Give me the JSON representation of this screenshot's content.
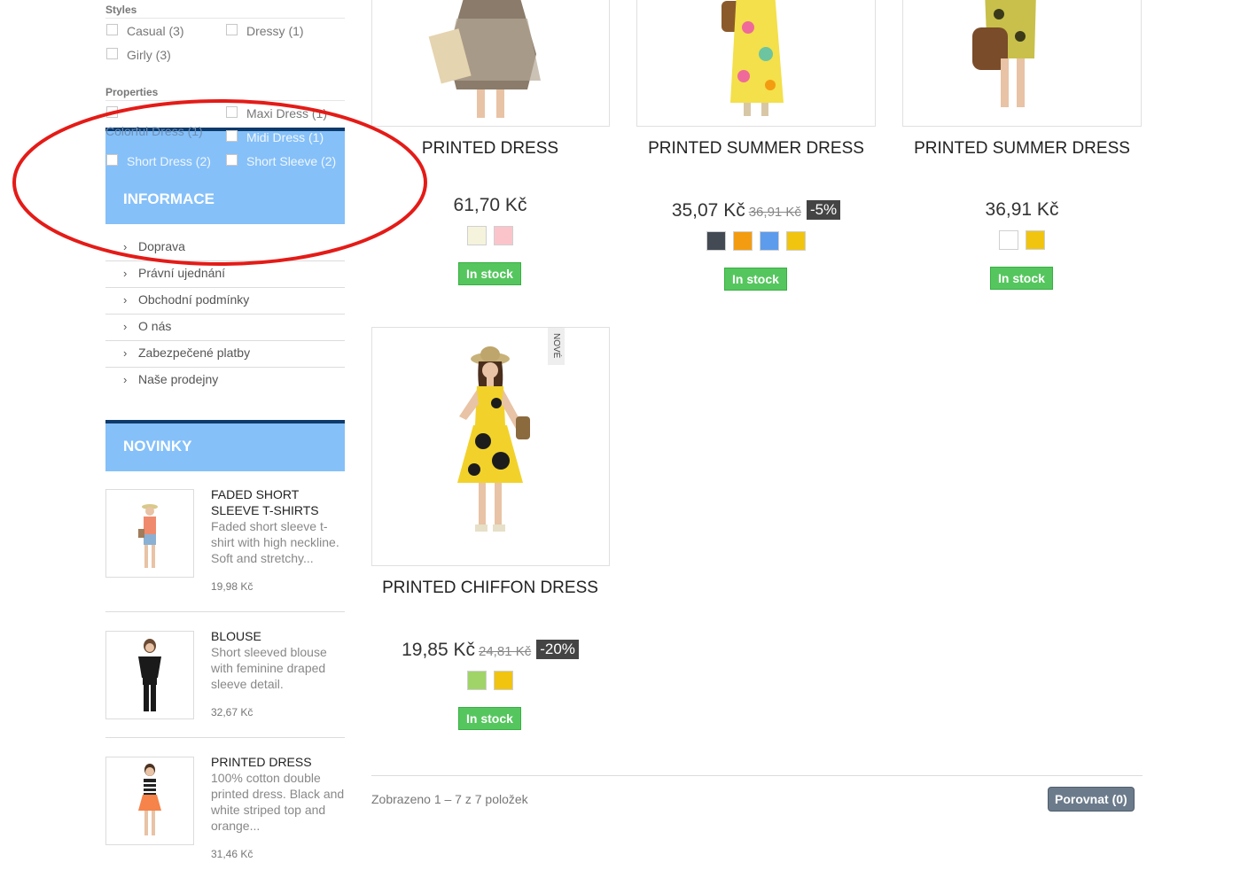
{
  "filters": {
    "styles": {
      "title": "Styles",
      "options": [
        {
          "label": "Casual (3)"
        },
        {
          "label": "Dressy (1)"
        },
        {
          "label": "Girly (3)"
        }
      ]
    },
    "properties": {
      "title": "Properties",
      "options": [
        {
          "label": "Colorful Dress (1)"
        },
        {
          "label": "Maxi Dress (1)"
        },
        {
          "label": "Midi Dress (1)"
        },
        {
          "label": "Short Dress (2)"
        },
        {
          "label": "Short Sleeve (2)"
        }
      ]
    }
  },
  "informace": {
    "title": "INFORMACE",
    "items": [
      {
        "label": "Doprava"
      },
      {
        "label": "Právní ujednání"
      },
      {
        "label": "Obchodní podmínky"
      },
      {
        "label": "O nás"
      },
      {
        "label": "Zabezpečené platby"
      },
      {
        "label": "Naše prodejny"
      }
    ]
  },
  "novinky": {
    "title": "NOVINKY",
    "items": [
      {
        "name": "FADED SHORT SLEEVE T-SHIRTS",
        "desc": "Faded short sleeve t-shirt with high neckline. Soft and stretchy...",
        "price": "19,98 Kč"
      },
      {
        "name": "BLOUSE",
        "desc": "Short sleeved blouse with feminine draped sleeve detail.",
        "price": "32,67 Kč"
      },
      {
        "name": "PRINTED DRESS",
        "desc": "100% cotton double printed dress. Black and white striped top and orange...",
        "price": "31,46 Kč"
      }
    ]
  },
  "products": [
    {
      "name": "PRINTED DRESS",
      "price": "61,70 Kč",
      "old_price": "",
      "discount": "",
      "colors": [
        "#f5f3dc",
        "#fbc4cb"
      ],
      "stock": "In stock"
    },
    {
      "name": "PRINTED SUMMER DRESS",
      "price": "35,07 Kč",
      "old_price": "36,91 Kč",
      "discount": "-5%",
      "colors": [
        "#434a54",
        "#f39c11",
        "#5d9cec",
        "#f1c40f"
      ],
      "stock": "In stock"
    },
    {
      "name": "PRINTED SUMMER DRESS",
      "price": "36,91 Kč",
      "old_price": "",
      "discount": "",
      "colors": [
        "#ffffff",
        "#f1c40f"
      ],
      "stock": "In stock"
    },
    {
      "name": "PRINTED CHIFFON DRESS",
      "price": "19,85 Kč",
      "old_price": "24,81 Kč",
      "discount": "-20%",
      "colors": [
        "#a0d468",
        "#f1c40f"
      ],
      "stock": "In stock",
      "badge": "NOVÉ"
    }
  ],
  "pagination": {
    "summary": "Zobrazeno 1 – 7 z 7 položek",
    "compare_label": "Porovnat (0)"
  },
  "colors": {
    "block_header": "#85c0f9",
    "block_top": "#0e3a6b",
    "in_stock": "#55c65e",
    "annotation": "#e41b17"
  }
}
